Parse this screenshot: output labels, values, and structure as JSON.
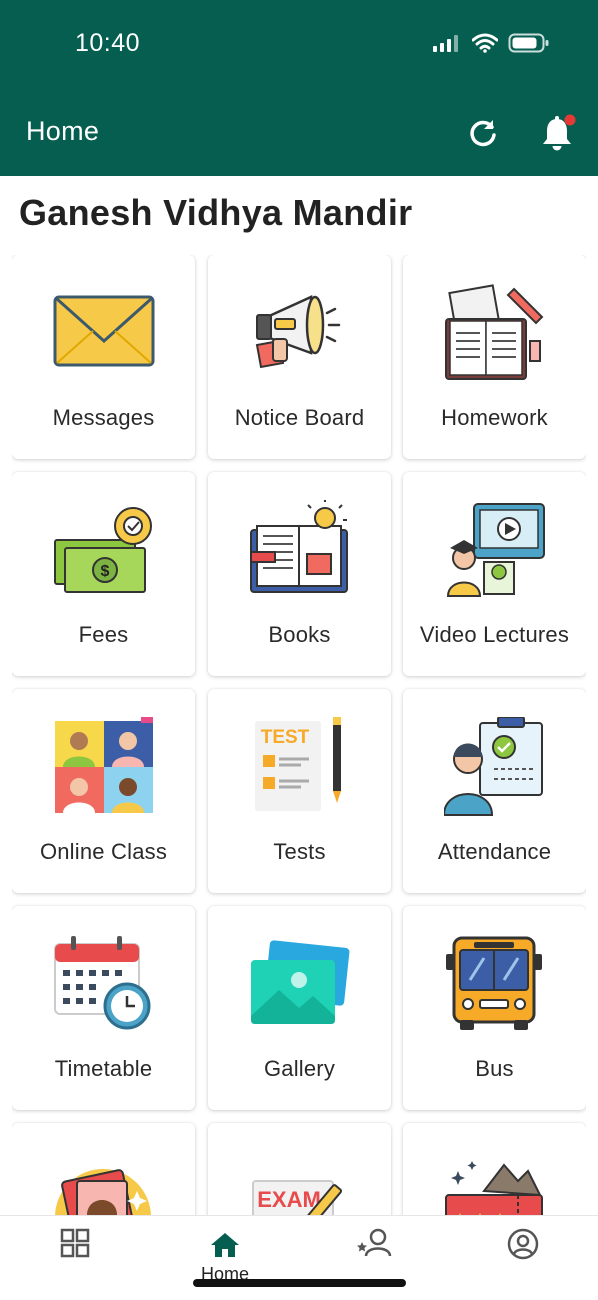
{
  "status_bar": {
    "time": "10:40"
  },
  "header": {
    "title": "Home",
    "accent": "#055e4f"
  },
  "school": {
    "name": "Ganesh Vidhya Mandir"
  },
  "menu": [
    {
      "label": "Messages",
      "icon": "envelope-icon"
    },
    {
      "label": "Notice Board",
      "icon": "megaphone-icon"
    },
    {
      "label": "Homework",
      "icon": "notebook-icon"
    },
    {
      "label": "Fees",
      "icon": "money-icon"
    },
    {
      "label": "Books",
      "icon": "book-icon"
    },
    {
      "label": "Video Lectures",
      "icon": "video-lecture-icon"
    },
    {
      "label": "Online Class",
      "icon": "video-call-icon"
    },
    {
      "label": "Tests",
      "icon": "test-icon"
    },
    {
      "label": "Attendance",
      "icon": "attendance-icon"
    },
    {
      "label": "Timetable",
      "icon": "calendar-icon"
    },
    {
      "label": "Gallery",
      "icon": "gallery-icon"
    },
    {
      "label": "Bus",
      "icon": "bus-icon"
    },
    {
      "label": "",
      "icon": "id-card-icon"
    },
    {
      "label": "",
      "icon": "exam-icon"
    },
    {
      "label": "",
      "icon": "ticket-icon"
    }
  ],
  "bottom_nav": {
    "active_label": "Home"
  }
}
